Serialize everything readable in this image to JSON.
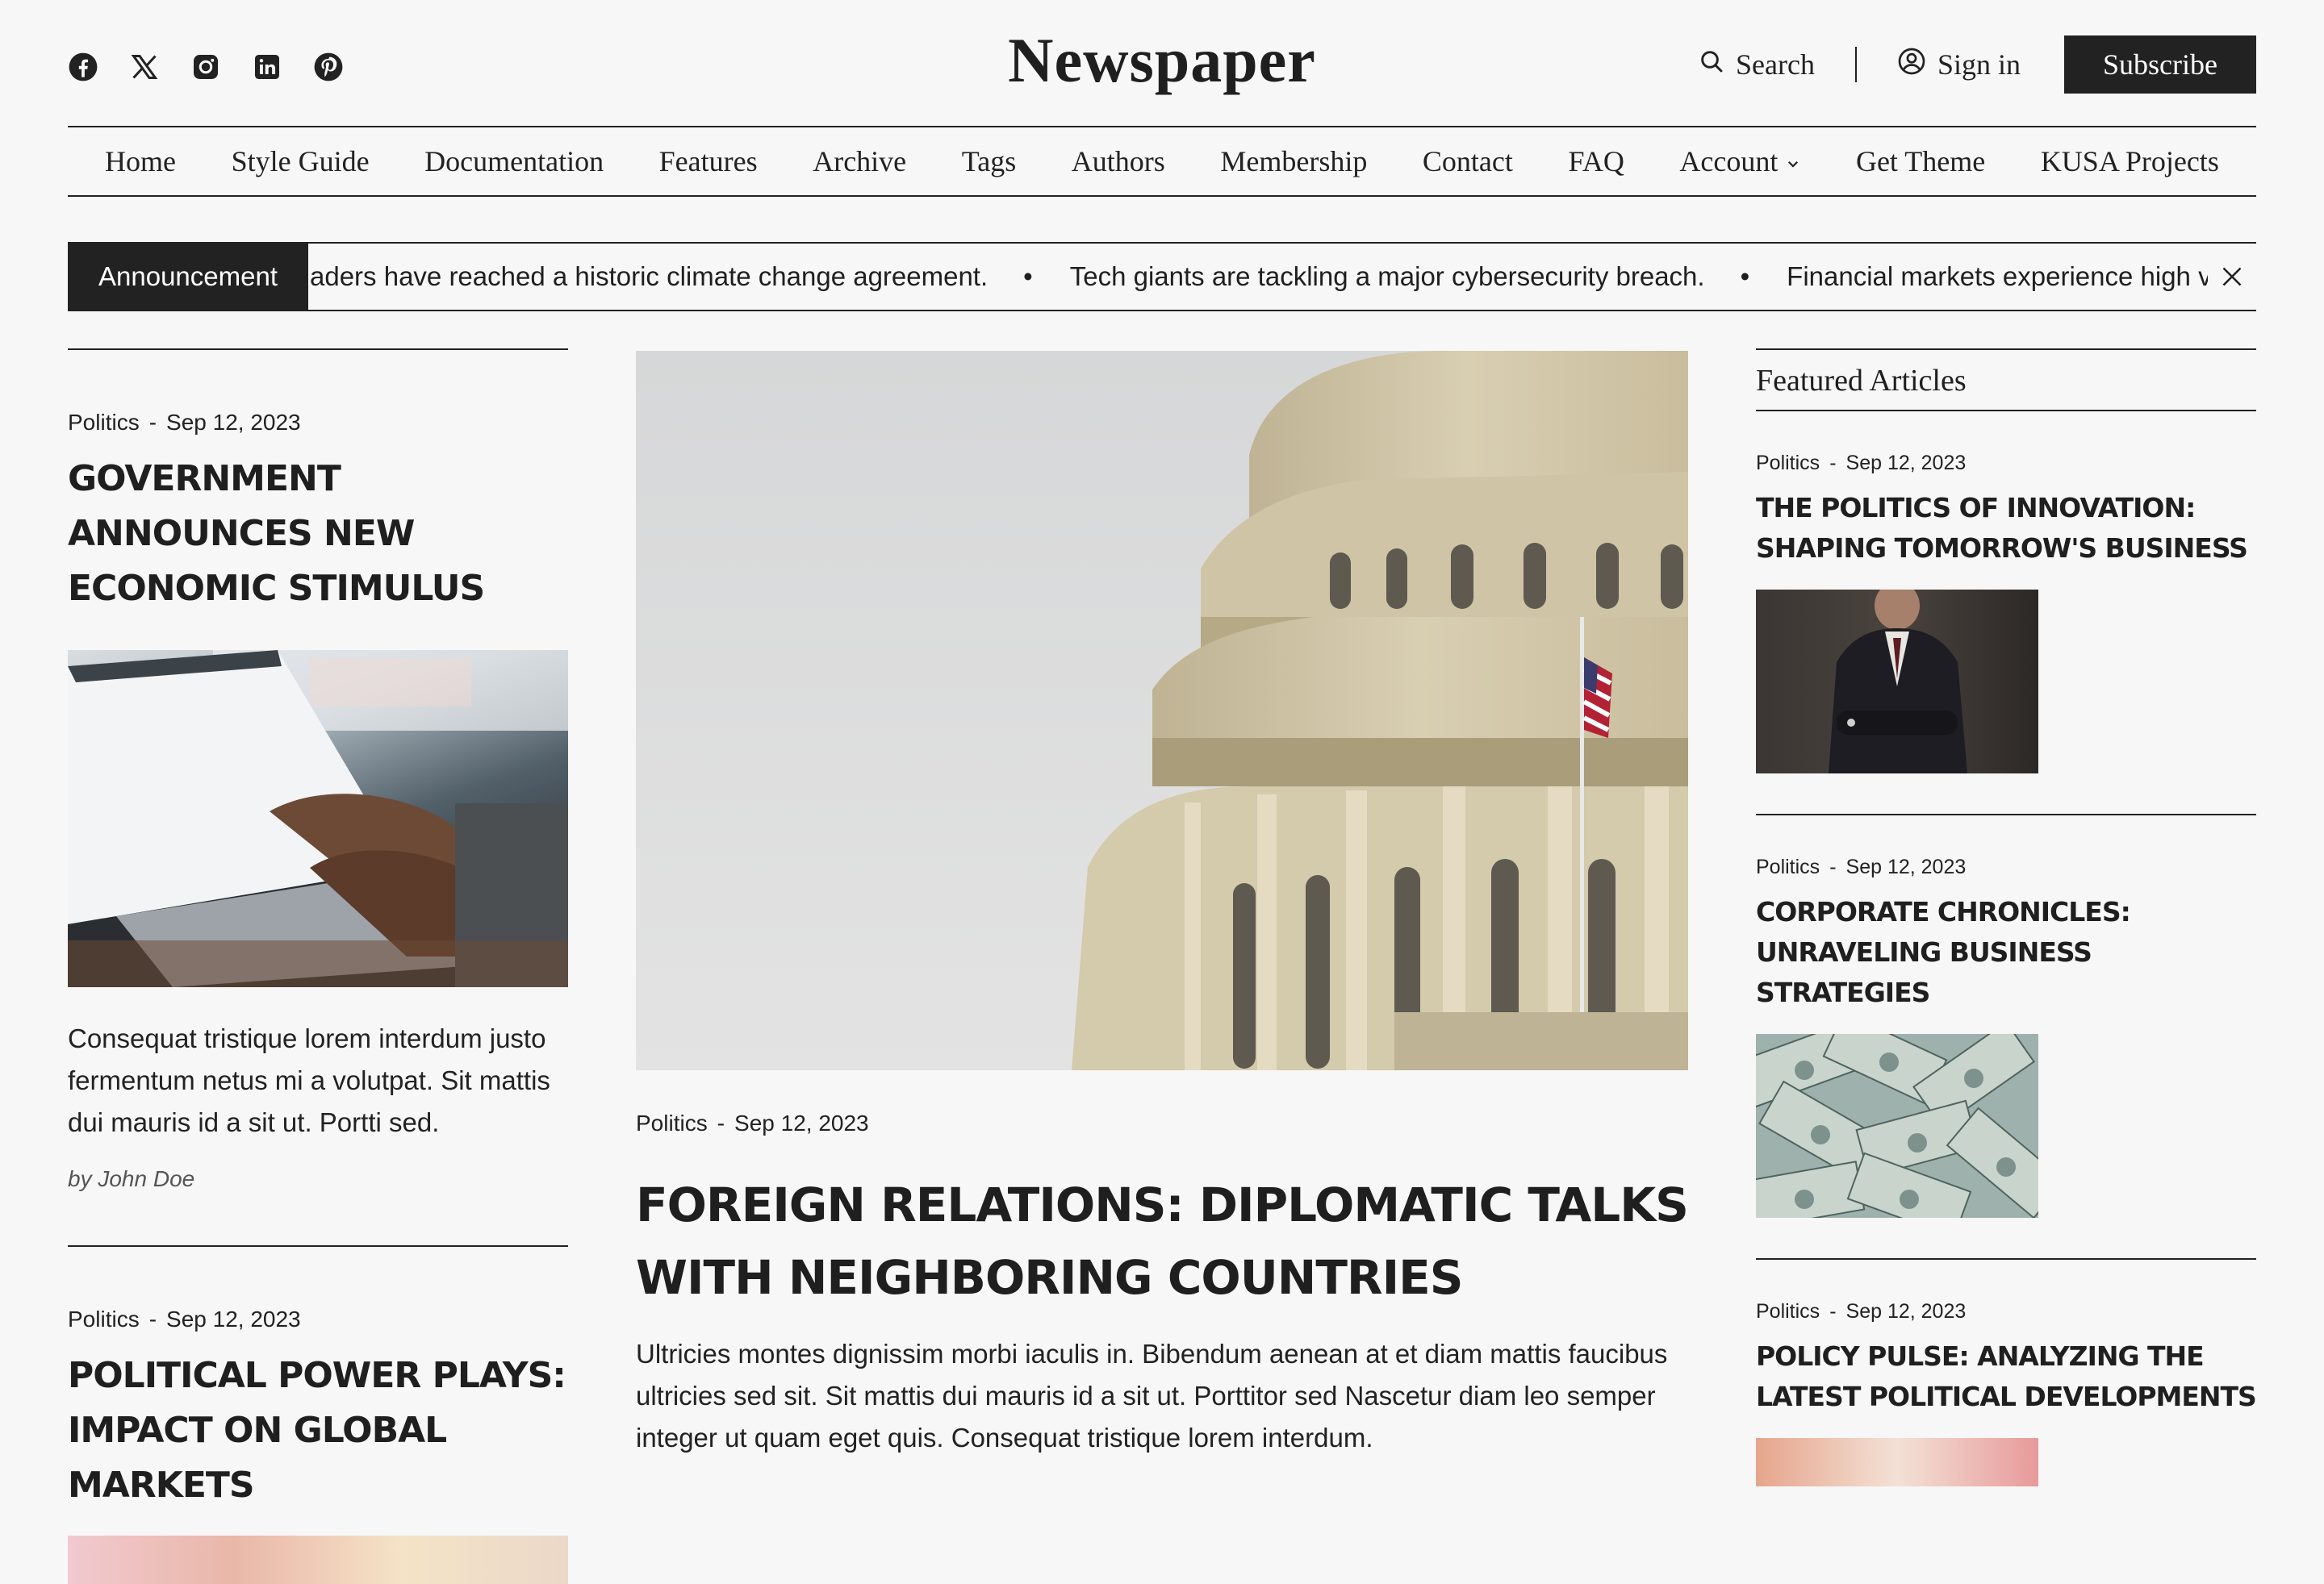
{
  "header": {
    "logo": "Newspaper",
    "search_label": "Search",
    "signin_label": "Sign in",
    "subscribe_label": "Subscribe",
    "social": [
      "facebook-icon",
      "x-icon",
      "instagram-icon",
      "linkedin-icon",
      "pinterest-icon"
    ]
  },
  "nav": {
    "items": [
      "Home",
      "Style Guide",
      "Documentation",
      "Features",
      "Archive",
      "Tags",
      "Authors",
      "Membership",
      "Contact",
      "FAQ",
      "Account",
      "Get Theme",
      "KUSA Projects"
    ]
  },
  "announcement": {
    "label": "Announcement",
    "items": [
      "aders have reached a historic climate change agreement.",
      "Tech giants are tackling a major cybersecurity breach.",
      "Financial markets experience high v"
    ]
  },
  "left": {
    "articles": [
      {
        "category": "Politics",
        "sep": "-",
        "date": "Sep 12, 2023",
        "title": "GOVERNMENT ANNOUNCES NEW ECONOMIC STIMULUS",
        "excerpt": "Consequat tristique lorem interdum justo fermentum netus mi a volutpat. Sit mattis dui mauris id a sit ut. Portti sed.",
        "author": "by John Doe"
      },
      {
        "category": "Politics",
        "sep": "-",
        "date": "Sep 12, 2023",
        "title": "POLITICAL POWER PLAYS: IMPACT ON GLOBAL MARKETS"
      }
    ]
  },
  "center": {
    "category": "Politics",
    "sep": "-",
    "date": "Sep 12, 2023",
    "title": "FOREIGN RELATIONS: DIPLOMATIC TALKS WITH NEIGHBORING COUNTRIES",
    "excerpt": "Ultricies montes dignissim morbi iaculis in. Bibendum aenean at et diam mattis faucibus ultricies sed sit. Sit mattis dui mauris id a sit ut. Porttitor sed  Nascetur diam leo semper integer ut quam eget quis. Consequat tristique lorem interdum."
  },
  "right": {
    "heading": "Featured Articles",
    "articles": [
      {
        "category": "Politics",
        "sep": "-",
        "date": "Sep 12, 2023",
        "title": "THE POLITICS OF INNOVATION: SHAPING TOMORROW'S BUSINESS"
      },
      {
        "category": "Politics",
        "sep": "-",
        "date": "Sep 12, 2023",
        "title": "CORPORATE CHRONICLES: UNRAVELING BUSINESS STRATEGIES"
      },
      {
        "category": "Politics",
        "sep": "-",
        "date": "Sep 12, 2023",
        "title": "POLICY PULSE: ANALYZING THE LATEST POLITICAL DEVELOPMENTS"
      }
    ]
  }
}
